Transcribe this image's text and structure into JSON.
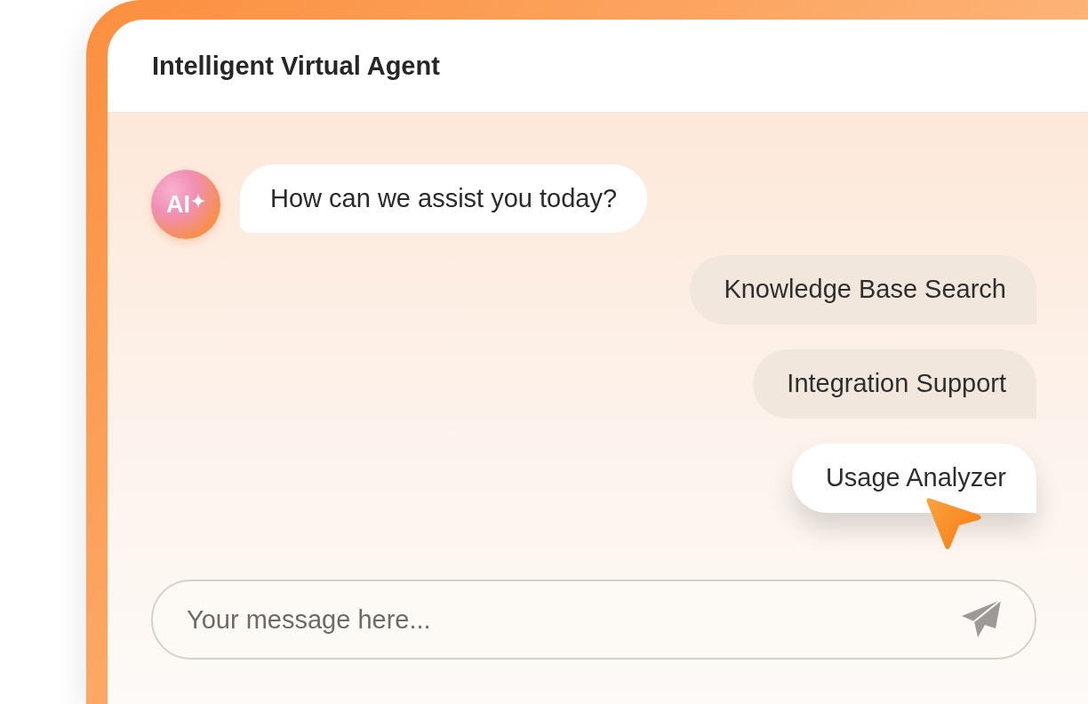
{
  "window": {
    "title": "Intelligent Virtual Agent"
  },
  "agent": {
    "avatar_label": "AI",
    "message": "How can we assist you today?"
  },
  "options": [
    {
      "label": "Knowledge Base Search",
      "selected": false
    },
    {
      "label": "Integration Support",
      "selected": false
    },
    {
      "label": "Usage Analyzer",
      "selected": true
    }
  ],
  "composer": {
    "placeholder": "Your message here..."
  }
}
